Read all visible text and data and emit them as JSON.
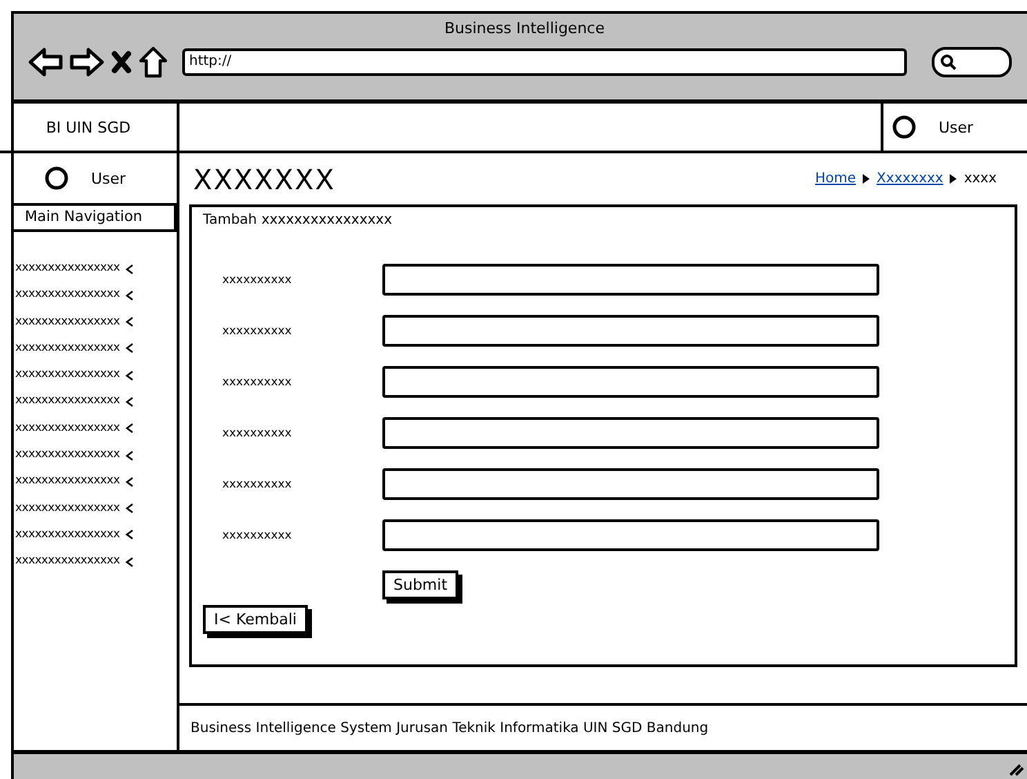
{
  "window": {
    "title": "Business Intelligence",
    "url": "http://"
  },
  "header": {
    "brand": "BI UIN SGD",
    "user": "User"
  },
  "sidebar": {
    "user": "User",
    "heading": "Main Navigation",
    "items": [
      {
        "label": "xxxxxxxxxxxxxxxx"
      },
      {
        "label": "xxxxxxxxxxxxxxxx"
      },
      {
        "label": "xxxxxxxxxxxxxxxx"
      },
      {
        "label": "xxxxxxxxxxxxxxxx"
      },
      {
        "label": "xxxxxxxxxxxxxxxx"
      },
      {
        "label": "xxxxxxxxxxxxxxxx"
      },
      {
        "label": "xxxxxxxxxxxxxxxx"
      },
      {
        "label": "xxxxxxxxxxxxxxxx"
      },
      {
        "label": "xxxxxxxxxxxxxxxx"
      },
      {
        "label": "xxxxxxxxxxxxxxxx"
      },
      {
        "label": "xxxxxxxxxxxxxxxx"
      },
      {
        "label": "xxxxxxxxxxxxxxxx"
      }
    ]
  },
  "page": {
    "title": "XXXXXXX",
    "breadcrumb": [
      {
        "label": "Home",
        "kind": "link"
      },
      {
        "label": "Xxxxxxxx",
        "kind": "link"
      },
      {
        "label": "xxxx",
        "kind": "current"
      }
    ]
  },
  "form": {
    "title": "Tambah xxxxxxxxxxxxxxxx",
    "fields": [
      {
        "label": "xxxxxxxxxx"
      },
      {
        "label": "xxxxxxxxxx"
      },
      {
        "label": "xxxxxxxxxx"
      },
      {
        "label": "xxxxxxxxxx"
      },
      {
        "label": "xxxxxxxxxx"
      },
      {
        "label": "xxxxxxxxxx"
      }
    ],
    "submit": "Submit",
    "back": "I< Kembali"
  },
  "footer": "Business Intelligence System Jurusan Teknik Informatika UIN SGD Bandung"
}
